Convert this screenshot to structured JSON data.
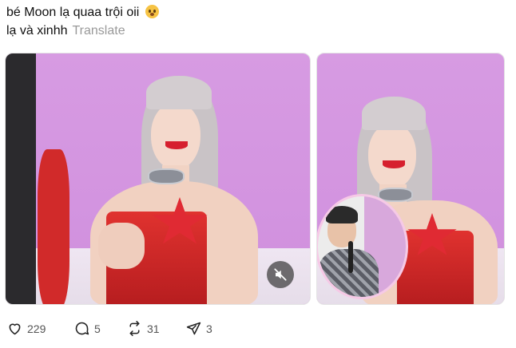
{
  "post": {
    "caption_line1": "bé Moon lạ quaa trội oii",
    "caption_line2": "lạ và xinhh",
    "translate_label": "Translate",
    "emoji": "pleading-face-emoji"
  },
  "media": {
    "items": [
      {
        "kind": "video",
        "mute_icon": "volume-muted-icon"
      },
      {
        "kind": "image",
        "has_inset": true
      }
    ]
  },
  "actions": {
    "likes": "229",
    "replies": "5",
    "reposts": "31",
    "shares": "3"
  },
  "colors": {
    "background": "#ffffff",
    "caption_text": "#101010",
    "translate_text": "#999999",
    "action_text": "#555555"
  }
}
